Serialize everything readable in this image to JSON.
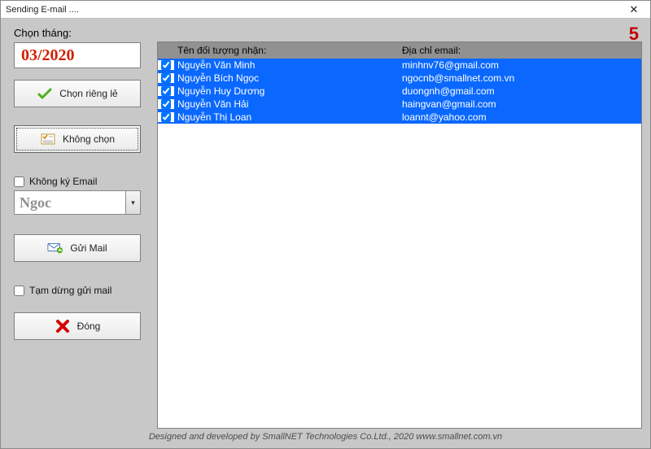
{
  "window": {
    "title": "Sending  E-mail ....",
    "close_glyph": "✕"
  },
  "counter": "5",
  "left": {
    "month_label": "Chọn tháng:",
    "month_value": "03/2020",
    "btn_select_some": "Chọn riêng lẻ",
    "btn_unselect": "Không chọn",
    "chk_no_sign": "Không ký Email",
    "sign_name": "Ngoc",
    "btn_send": "Gửi Mail",
    "chk_pause": "Tạm dừng gửi mail",
    "btn_close": "Đóng"
  },
  "list": {
    "header_name": "Tên đối tượng nhận:",
    "header_email": "Địa chỉ email:",
    "rows": [
      {
        "checked": true,
        "name": "Nguyễn Văn Minh",
        "email": "minhnv76@gmail.com"
      },
      {
        "checked": true,
        "name": "Nguyễn Bích Ngọc",
        "email": "ngocnb@smallnet.com.vn"
      },
      {
        "checked": true,
        "name": "Nguyễn Huy Dương",
        "email": "duongnh@gmail.com"
      },
      {
        "checked": true,
        "name": "Nguyễn Văn Hải",
        "email": "haingvan@gmail.com"
      },
      {
        "checked": true,
        "name": "Nguyễn Thị Loan",
        "email": "loannt@yahoo.com"
      }
    ]
  },
  "footer": "Designed and developed by SmallNET Technologies Co.Ltd., 2020   www.smallnet.com.vn"
}
